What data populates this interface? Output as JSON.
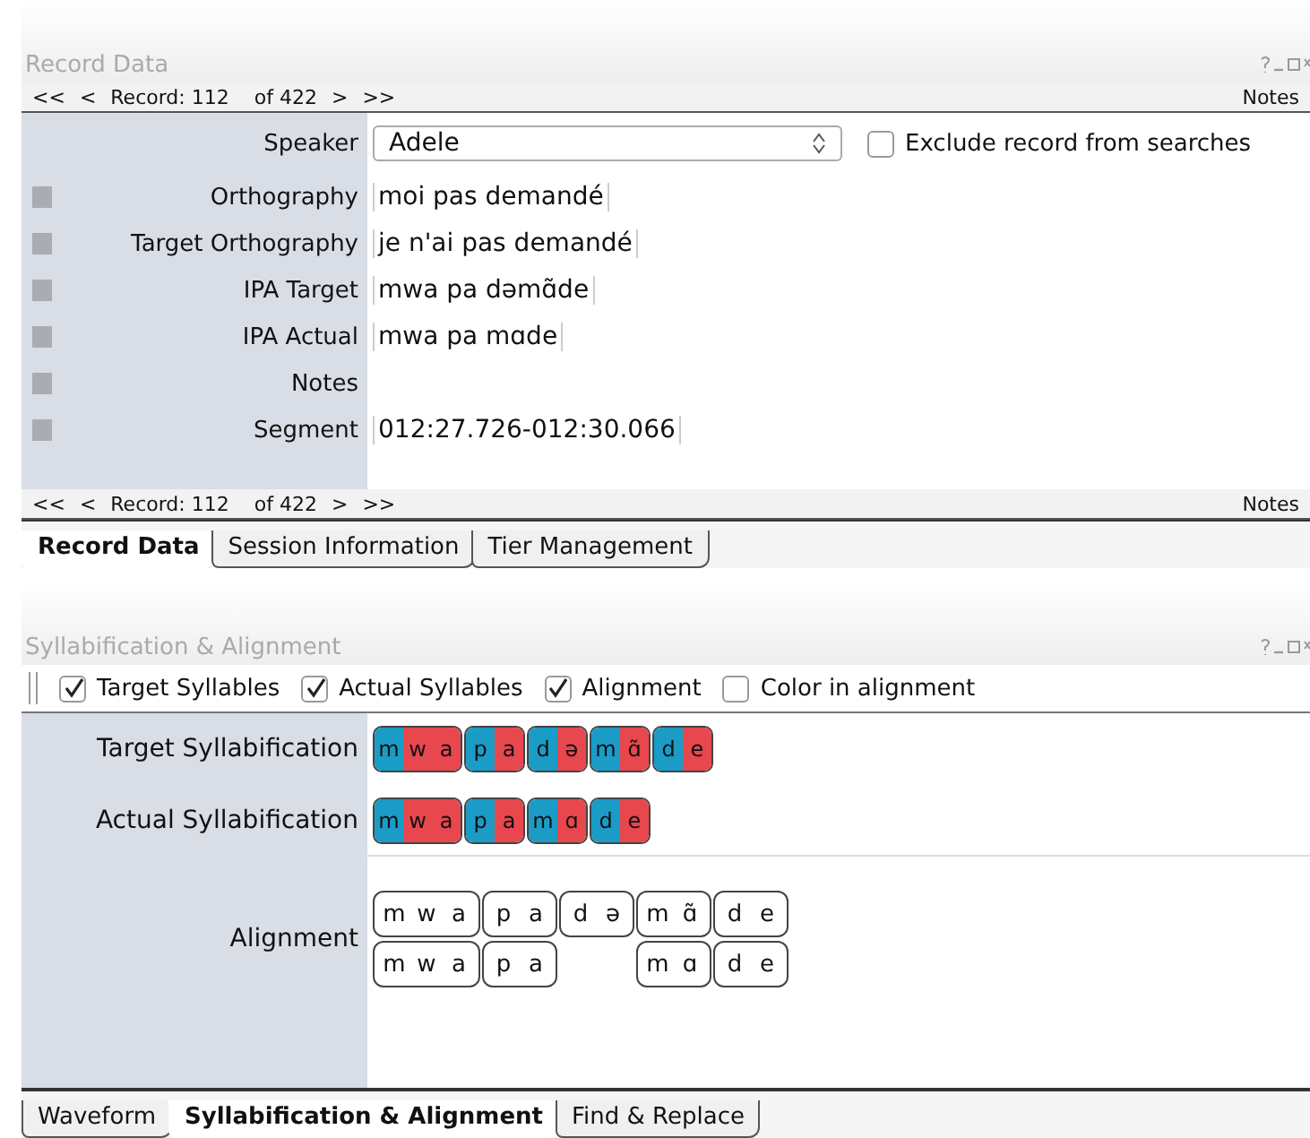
{
  "record_panel": {
    "title": "Record Data",
    "nav_top": {
      "first": "<<",
      "prev": "<",
      "record": "Record: 112",
      "of": "of 422",
      "next": ">",
      "last": ">>",
      "notes": "Notes"
    },
    "speaker": {
      "label": "Speaker",
      "value": "Adele"
    },
    "exclude": {
      "label": "Exclude record from searches",
      "checked": false
    },
    "tiers": [
      {
        "label": "Orthography",
        "value": "moi pas demandé"
      },
      {
        "label": "Target Orthography",
        "value": "je n'ai pas demandé"
      },
      {
        "label": "IPA Target",
        "value": "mwa pa dəmɑ̃de"
      },
      {
        "label": "IPA Actual",
        "value": "mwa pa mɑde"
      },
      {
        "label": "Notes"
      },
      {
        "label": "Segment",
        "value": "012:27.726-012:30.066"
      }
    ],
    "nav_bottom": {
      "first": "<<",
      "prev": "<",
      "record": "Record: 112",
      "of": "of 422",
      "next": ">",
      "last": ">>",
      "notes": "Notes"
    },
    "tabs": [
      {
        "label": "Record Data",
        "selected": true
      },
      {
        "label": "Session Information",
        "selected": false
      },
      {
        "label": "Tier Management",
        "selected": false
      }
    ]
  },
  "syllable_panel": {
    "title": "Syllabification & Alignment",
    "options": [
      {
        "label": "Target Syllables",
        "checked": true
      },
      {
        "label": "Actual Syllables",
        "checked": true
      },
      {
        "label": "Alignment",
        "checked": true
      },
      {
        "label": "Color in alignment",
        "checked": false
      }
    ],
    "target_label": "Target Syllabification",
    "target": [
      [
        {
          "text": "m",
          "kind": "onset"
        },
        {
          "text": "w",
          "kind": "nucleus"
        },
        {
          "text": "a",
          "kind": "nucleus"
        }
      ],
      [
        {
          "text": "p",
          "kind": "onset"
        },
        {
          "text": "a",
          "kind": "nucleus"
        }
      ],
      [
        {
          "text": "d",
          "kind": "onset"
        },
        {
          "text": "ə",
          "kind": "nucleus"
        }
      ],
      [
        {
          "text": "m",
          "kind": "onset"
        },
        {
          "text": "ɑ̃",
          "kind": "nucleus"
        }
      ],
      [
        {
          "text": "d",
          "kind": "onset"
        },
        {
          "text": "e",
          "kind": "nucleus"
        }
      ]
    ],
    "actual_label": "Actual Syllabification",
    "actual": [
      [
        {
          "text": "m",
          "kind": "onset"
        },
        {
          "text": "w",
          "kind": "nucleus"
        },
        {
          "text": "a",
          "kind": "nucleus"
        }
      ],
      [
        {
          "text": "p",
          "kind": "onset"
        },
        {
          "text": "a",
          "kind": "nucleus"
        }
      ],
      [
        {
          "text": "m",
          "kind": "onset"
        },
        {
          "text": "ɑ",
          "kind": "nucleus"
        }
      ],
      [
        {
          "text": "d",
          "kind": "onset"
        },
        {
          "text": "e",
          "kind": "nucleus"
        }
      ]
    ],
    "alignment_label": "Alignment",
    "alignment": [
      {
        "target": [
          "m",
          "w",
          "a"
        ],
        "actual": [
          "m",
          "w",
          "a"
        ]
      },
      {
        "target": [
          "p",
          "a"
        ],
        "actual": [
          "p",
          "a"
        ]
      },
      {
        "target": [
          "d",
          "ə"
        ]
      },
      {
        "target": [
          "m",
          "ɑ̃"
        ],
        "actual": [
          "m",
          "ɑ"
        ]
      },
      {
        "target": [
          "d",
          "e"
        ],
        "actual": [
          "d",
          "e"
        ]
      }
    ],
    "tabs": [
      {
        "label": "Waveform",
        "selected": false
      },
      {
        "label": "Syllabification & Alignment",
        "selected": true
      },
      {
        "label": "Find & Replace",
        "selected": false
      }
    ]
  }
}
